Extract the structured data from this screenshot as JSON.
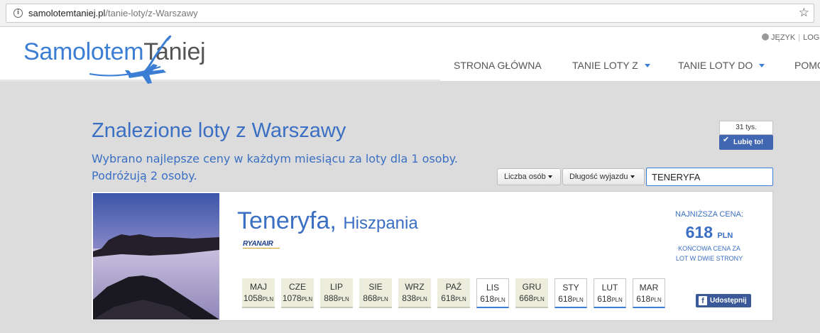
{
  "browser": {
    "url_domain": "samolotemtaniej.pl",
    "url_path": "/tanie-loty/z-Warszawy"
  },
  "header": {
    "logo_part1": "Samolotem",
    "logo_part2": "Taniej",
    "lang_label": "JĘZYK",
    "logout_label": "LOGO",
    "nav": [
      "STRONA GŁÓWNA",
      "TANIE LOTY Z",
      "TANIE LOTY DO",
      "POMO"
    ]
  },
  "main": {
    "title": "Znalezione loty z Warszawy",
    "subtitle_line1": "Wybrano najlepsze ceny w każdym miesiącu za loty dla 1 osoby.",
    "subtitle_line2": "Podróżują 2 osoby.",
    "like_count": "31 tys.",
    "like_label": "Lubię to!",
    "filters": {
      "persons_label": "Liczba osób",
      "duration_label": "Długość wyjazdu",
      "search_value": "TENERYFA"
    }
  },
  "result": {
    "destination": "Teneryfa,",
    "country": "Hiszpania",
    "airline": "RYANAIR",
    "lowest_price_label": "NAJNIŻSZA CENA:",
    "lowest_price_value": "618",
    "currency": "PLN",
    "price_note_line1": "KOŃCOWA CENA ZA",
    "price_note_line2": "LOT W DWIE STRONY",
    "share_label": "Udostępnij",
    "months": [
      {
        "name": "MAJ",
        "price": "1058",
        "unit": "PLN",
        "highlight": false
      },
      {
        "name": "CZE",
        "price": "1078",
        "unit": "PLN",
        "highlight": false
      },
      {
        "name": "LIP",
        "price": "888",
        "unit": "PLN",
        "highlight": false
      },
      {
        "name": "SIE",
        "price": "868",
        "unit": "PLN",
        "highlight": false
      },
      {
        "name": "WRZ",
        "price": "838",
        "unit": "PLN",
        "highlight": false
      },
      {
        "name": "PAŹ",
        "price": "618",
        "unit": "PLN",
        "highlight": false
      },
      {
        "name": "LIS",
        "price": "618",
        "unit": "PLN",
        "highlight": true
      },
      {
        "name": "GRU",
        "price": "668",
        "unit": "PLN",
        "highlight": false
      },
      {
        "name": "STY",
        "price": "618",
        "unit": "PLN",
        "highlight": true
      },
      {
        "name": "LUT",
        "price": "618",
        "unit": "PLN",
        "highlight": true
      },
      {
        "name": "MAR",
        "price": "618",
        "unit": "PLN",
        "highlight": true
      }
    ]
  },
  "colors": {
    "accent_blue": "#3a6fc3",
    "facebook_blue": "#3b5998",
    "month_bg": "#ededdd"
  }
}
